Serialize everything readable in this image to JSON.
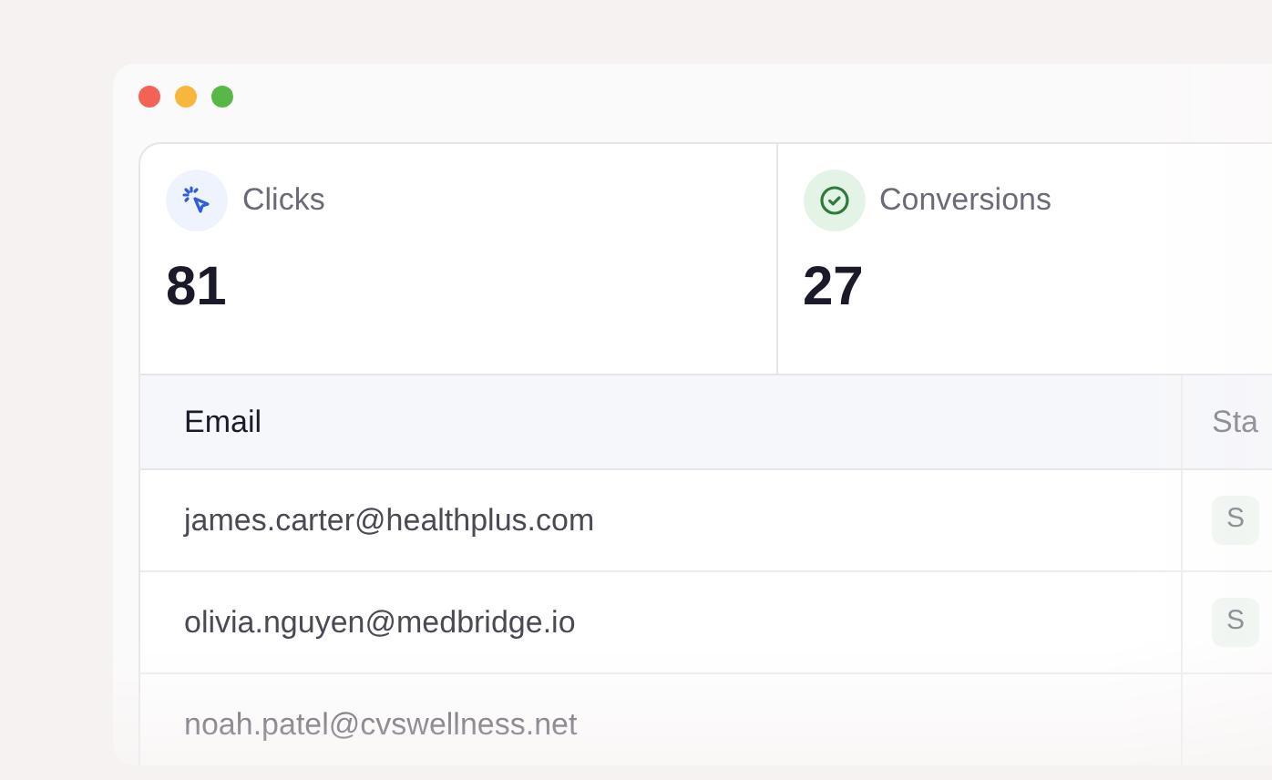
{
  "stats": [
    {
      "kind": "clicks",
      "label": "Clicks",
      "value": "81"
    },
    {
      "kind": "conversions",
      "label": "Conversions",
      "value": "27"
    }
  ],
  "table": {
    "columns": [
      "Email",
      "Sta"
    ],
    "rows": [
      {
        "email": "james.carter@healthplus.com",
        "status": "S"
      },
      {
        "email": "olivia.nguyen@medbridge.io",
        "status": "S"
      },
      {
        "email": "noah.patel@cvswellness.net"
      }
    ]
  }
}
